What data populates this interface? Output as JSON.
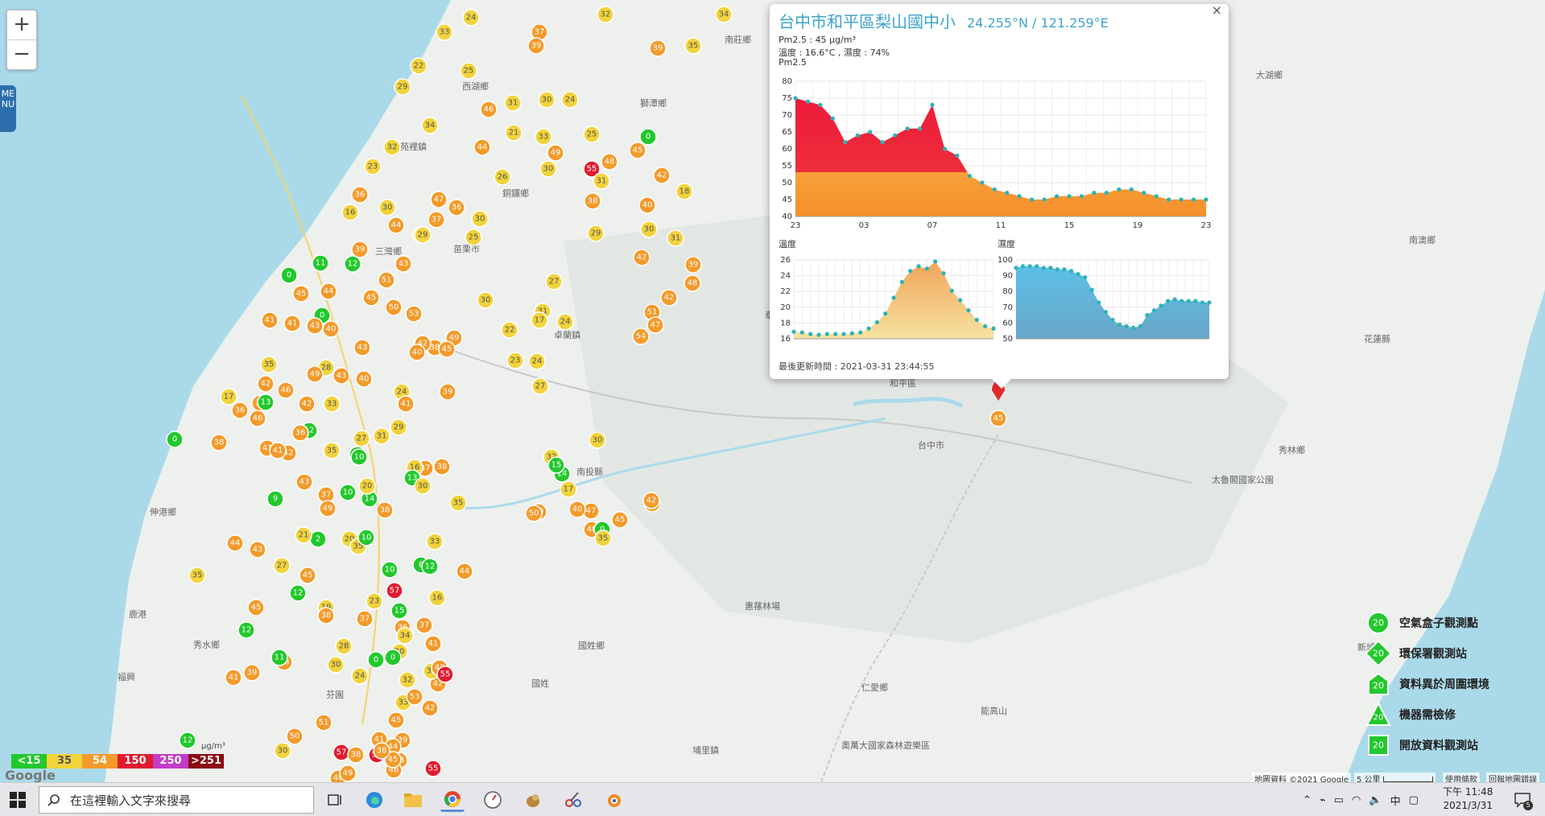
{
  "map": {
    "zoom_in": "+",
    "zoom_out": "−",
    "menu_label": "MENU",
    "places": [
      "南莊鄉",
      "獅潭鄉",
      "大湖鄉",
      "泰安鄉",
      "卓蘭鎮",
      "和平區",
      "南澳鄉",
      "秀林鄉",
      "太魯閣國家公園",
      "仁愛鄉",
      "惠蓀林場",
      "國姓鄉",
      "埔里鎮",
      "鹿港",
      "秀水鄉",
      "福興",
      "伸港鄉",
      "西湖鄉",
      "苑裡鎮",
      "苗栗市",
      "三灣鄉",
      "銅鑼鄉",
      "花蓮縣",
      "奧萬大國家森林遊樂區",
      "能高山",
      "新城",
      "台中市",
      "芬園",
      "國姓",
      "南投縣"
    ],
    "scale_label": "μg/m³"
  },
  "popup": {
    "close": "×",
    "title": "台中市和平區梨山國中小",
    "coord": "24.255°N / 121.259°E",
    "pm25_line": "Pm2.5 : 45 μg/m³",
    "temp_hum_line": "溫度 : 16.6°C , 濕度 : 74%",
    "chart_title": "Pm2.5",
    "temp_title": "溫度",
    "hum_title": "濕度",
    "updated": "最後更新時間 : 2021-03-31 23:44:55"
  },
  "chart_data": [
    {
      "type": "area",
      "title": "Pm2.5",
      "x_tick_labels": [
        "23",
        "03",
        "07",
        "11",
        "15",
        "19",
        "23"
      ],
      "ylim": [
        40,
        80
      ],
      "y_ticks": [
        40,
        45,
        50,
        55,
        60,
        65,
        70,
        75,
        80
      ],
      "values": [
        75,
        74,
        73,
        69,
        62,
        64,
        65,
        62,
        64,
        66,
        66,
        73,
        60,
        58,
        52,
        50,
        48,
        47,
        46,
        45,
        45,
        46,
        46,
        46,
        47,
        47,
        48,
        48,
        47,
        46,
        45,
        45,
        45,
        45
      ]
    },
    {
      "type": "area",
      "title": "溫度",
      "ylim": [
        16,
        26
      ],
      "y_ticks": [
        16,
        18,
        20,
        22,
        24,
        26
      ],
      "values": [
        16.9,
        16.8,
        16.6,
        16.5,
        16.6,
        16.6,
        16.6,
        16.7,
        16.8,
        17.3,
        18.1,
        19.2,
        21.2,
        23.2,
        24.6,
        25.2,
        24.9,
        25.8,
        24.3,
        22.1,
        20.9,
        19.6,
        18.4,
        17.6,
        17.3
      ]
    },
    {
      "type": "area",
      "title": "濕度",
      "ylim": [
        50,
        100
      ],
      "y_ticks": [
        50,
        60,
        70,
        80,
        90,
        100
      ],
      "values": [
        95,
        96,
        96,
        96,
        95,
        95,
        94,
        94,
        93,
        91,
        89,
        81,
        73,
        67,
        62,
        59,
        58,
        57,
        58,
        65,
        68,
        71,
        74,
        75,
        74,
        74,
        74,
        73,
        73
      ]
    }
  ],
  "scale": {
    "labels": [
      "<15",
      "35",
      "54",
      "150",
      "250",
      ">251"
    ],
    "colors": [
      "#22c82c",
      "#f2d33c",
      "#f39a2a",
      "#e01b30",
      "#c43cc8",
      "#8b0a12"
    ]
  },
  "attribution": {
    "data": "地圖資料 ©2021 Google",
    "distance": "5 公里",
    "terms": "使用條款",
    "report": "回報地圖錯誤",
    "google": "Google"
  },
  "legend": {
    "items": [
      {
        "label": "空氣盒子觀測點",
        "value": "20"
      },
      {
        "label": "環保署觀測站",
        "value": "20"
      },
      {
        "label": "資料異於周圍環境",
        "value": "20"
      },
      {
        "label": "機器需檢修",
        "value": "20"
      },
      {
        "label": "開放資料觀測站",
        "value": "20"
      }
    ]
  },
  "taskbar": {
    "search_placeholder": "在這裡輸入文字來搜尋",
    "ime": "中",
    "time": "下午 11:48",
    "date": "2021/3/31",
    "notification_count": "5"
  },
  "markers": [
    {
      "v": "33",
      "c": "#f2d33c"
    },
    {
      "v": "24",
      "c": "#f2d33c"
    },
    {
      "v": "37",
      "c": "#f39a2a"
    },
    {
      "v": "32",
      "c": "#f2d33c"
    },
    {
      "v": "34",
      "c": "#f2d33c"
    },
    {
      "v": "22",
      "c": "#f2d33c"
    },
    {
      "v": "29",
      "c": "#f2d33c"
    },
    {
      "v": "25",
      "c": "#f2d33c"
    },
    {
      "v": "39",
      "c": "#f39a2a"
    },
    {
      "v": "35",
      "c": "#f2d33c"
    },
    {
      "v": "39",
      "c": "#f39a2a"
    },
    {
      "v": "46",
      "c": "#f39a2a"
    },
    {
      "v": "31",
      "c": "#f2d33c"
    },
    {
      "v": "30",
      "c": "#f2d33c"
    },
    {
      "v": "24",
      "c": "#f2d33c"
    },
    {
      "v": "34",
      "c": "#f2d33c"
    },
    {
      "v": "32",
      "c": "#f2d33c"
    },
    {
      "v": "44",
      "c": "#f39a2a"
    },
    {
      "v": "21",
      "c": "#f2d33c"
    },
    {
      "v": "33",
      "c": "#f2d33c"
    },
    {
      "v": "48",
      "c": "#f39a2a"
    },
    {
      "v": "42",
      "c": "#f39a2a"
    },
    {
      "v": "23",
      "c": "#f2d33c"
    },
    {
      "v": "26",
      "c": "#f2d33c"
    },
    {
      "v": "30",
      "c": "#f2d33c"
    },
    {
      "v": "36",
      "c": "#f39a2a"
    },
    {
      "v": "30",
      "c": "#f2d33c"
    },
    {
      "v": "47",
      "c": "#f39a2a"
    },
    {
      "v": "36",
      "c": "#f39a2a"
    },
    {
      "v": "16",
      "c": "#f2d33c"
    },
    {
      "v": "30",
      "c": "#f2d33c"
    },
    {
      "v": "44",
      "c": "#f39a2a"
    },
    {
      "v": "25",
      "c": "#f2d33c"
    },
    {
      "v": "37",
      "c": "#f39a2a"
    },
    {
      "v": "38",
      "c": "#f39a2a"
    },
    {
      "v": "40",
      "c": "#f39a2a"
    },
    {
      "v": "29",
      "c": "#f2d33c"
    },
    {
      "v": "25",
      "c": "#f2d33c"
    },
    {
      "v": "39",
      "c": "#f39a2a"
    },
    {
      "v": "43",
      "c": "#f39a2a"
    },
    {
      "v": "42",
      "c": "#f39a2a"
    },
    {
      "v": "0",
      "c": "#22c82c"
    },
    {
      "v": "11",
      "c": "#22c82c"
    },
    {
      "v": "12",
      "c": "#22c82c"
    },
    {
      "v": "51",
      "c": "#f39a2a"
    },
    {
      "v": "27",
      "c": "#f2d33c"
    },
    {
      "v": "30",
      "c": "#f2d33c"
    },
    {
      "v": "39",
      "c": "#f39a2a"
    },
    {
      "v": "48",
      "c": "#f39a2a"
    },
    {
      "v": "45",
      "c": "#f39a2a"
    },
    {
      "v": "44",
      "c": "#f39a2a"
    },
    {
      "v": "45",
      "c": "#f39a2a"
    },
    {
      "v": "50",
      "c": "#f39a2a"
    },
    {
      "v": "53",
      "c": "#f39a2a"
    },
    {
      "v": "31",
      "c": "#f2d33c"
    },
    {
      "v": "24",
      "c": "#f2d33c"
    },
    {
      "v": "42",
      "c": "#f39a2a"
    },
    {
      "v": "51",
      "c": "#f39a2a"
    },
    {
      "v": "47",
      "c": "#f39a2a"
    },
    {
      "v": "41",
      "c": "#f39a2a"
    },
    {
      "v": "41",
      "c": "#f39a2a"
    },
    {
      "v": "0",
      "c": "#22c82c"
    },
    {
      "v": "43",
      "c": "#f39a2a"
    },
    {
      "v": "40",
      "c": "#f39a2a"
    },
    {
      "v": "54",
      "c": "#f39a2a"
    },
    {
      "v": "49",
      "c": "#f39a2a"
    },
    {
      "v": "38",
      "c": "#f39a2a"
    },
    {
      "v": "43",
      "c": "#f39a2a"
    },
    {
      "v": "45",
      "c": "#f39a2a"
    },
    {
      "v": "28",
      "c": "#f2d33c"
    },
    {
      "v": "35",
      "c": "#f2d33c"
    },
    {
      "v": "42",
      "c": "#f39a2a"
    },
    {
      "v": "46",
      "c": "#f39a2a"
    },
    {
      "v": "49",
      "c": "#f39a2a"
    },
    {
      "v": "42",
      "c": "#f39a2a"
    },
    {
      "v": "40",
      "c": "#f39a2a"
    },
    {
      "v": "43",
      "c": "#f39a2a"
    },
    {
      "v": "40",
      "c": "#f39a2a"
    },
    {
      "v": "24",
      "c": "#f2d33c"
    },
    {
      "v": "39",
      "c": "#f39a2a"
    },
    {
      "v": "41",
      "c": "#f39a2a"
    },
    {
      "v": "33",
      "c": "#f2d33c"
    },
    {
      "v": "17",
      "c": "#f2d33c"
    },
    {
      "v": "39",
      "c": "#f39a2a"
    },
    {
      "v": "13",
      "c": "#22c82c"
    },
    {
      "v": "36",
      "c": "#f39a2a"
    },
    {
      "v": "42",
      "c": "#f39a2a"
    },
    {
      "v": "12",
      "c": "#22c82c"
    },
    {
      "v": "0",
      "c": "#22c82c"
    },
    {
      "v": "38",
      "c": "#f39a2a"
    },
    {
      "v": "36",
      "c": "#f39a2a"
    },
    {
      "v": "46",
      "c": "#f39a2a"
    },
    {
      "v": "42",
      "c": "#f39a2a"
    },
    {
      "v": "43",
      "c": "#f39a2a"
    },
    {
      "v": "41",
      "c": "#f39a2a"
    },
    {
      "v": "7",
      "c": "#22c82c"
    },
    {
      "v": "35",
      "c": "#f2d33c"
    },
    {
      "v": "37",
      "c": "#f39a2a"
    },
    {
      "v": "10",
      "c": "#22c82c"
    },
    {
      "v": "31",
      "c": "#f2d33c"
    },
    {
      "v": "29",
      "c": "#f2d33c"
    },
    {
      "v": "27",
      "c": "#f2d33c"
    },
    {
      "v": "16",
      "c": "#f2d33c"
    },
    {
      "v": "38",
      "c": "#f39a2a"
    },
    {
      "v": "13",
      "c": "#22c82c"
    },
    {
      "v": "43",
      "c": "#f39a2a"
    },
    {
      "v": "37",
      "c": "#f39a2a"
    },
    {
      "v": "30",
      "c": "#f2d33c"
    },
    {
      "v": "9",
      "c": "#22c82c"
    },
    {
      "v": "35",
      "c": "#f2d33c"
    },
    {
      "v": "14",
      "c": "#22c82c"
    },
    {
      "v": "10",
      "c": "#22c82c"
    },
    {
      "v": "20",
      "c": "#f2d33c"
    },
    {
      "v": "38",
      "c": "#f39a2a"
    },
    {
      "v": "49",
      "c": "#f39a2a"
    },
    {
      "v": "2",
      "c": "#22c82c"
    },
    {
      "v": "33",
      "c": "#f2d33c"
    },
    {
      "v": "8",
      "c": "#22c82c"
    },
    {
      "v": "12",
      "c": "#22c82c"
    },
    {
      "v": "44",
      "c": "#f39a2a"
    },
    {
      "v": "20",
      "c": "#f2d33c"
    },
    {
      "v": "21",
      "c": "#f2d33c"
    },
    {
      "v": "35",
      "c": "#f2d33c"
    },
    {
      "v": "10",
      "c": "#22c82c"
    },
    {
      "v": "44",
      "c": "#f39a2a"
    },
    {
      "v": "43",
      "c": "#f39a2a"
    },
    {
      "v": "10",
      "c": "#22c82c"
    },
    {
      "v": "45",
      "c": "#f39a2a"
    },
    {
      "v": "27",
      "c": "#f2d33c"
    },
    {
      "v": "35",
      "c": "#f2d33c"
    },
    {
      "v": "12",
      "c": "#22c82c"
    },
    {
      "v": "12",
      "c": "#22c82c"
    },
    {
      "v": "45",
      "c": "#f39a2a"
    },
    {
      "v": "57",
      "c": "#e01b30"
    },
    {
      "v": "23",
      "c": "#f2d33c"
    },
    {
      "v": "16",
      "c": "#f2d33c"
    },
    {
      "v": "15",
      "c": "#22c82c"
    },
    {
      "v": "37",
      "c": "#f39a2a"
    },
    {
      "v": "36",
      "c": "#f39a2a"
    },
    {
      "v": "19",
      "c": "#f2d33c"
    },
    {
      "v": "34",
      "c": "#f2d33c"
    },
    {
      "v": "41",
      "c": "#f39a2a"
    },
    {
      "v": "42",
      "c": "#f39a2a"
    },
    {
      "v": "38",
      "c": "#f39a2a"
    },
    {
      "v": "20",
      "c": "#f2d33c"
    },
    {
      "v": "37",
      "c": "#f39a2a"
    },
    {
      "v": "28",
      "c": "#f2d33c"
    },
    {
      "v": "30",
      "c": "#f2d33c"
    },
    {
      "v": "48",
      "c": "#f39a2a"
    },
    {
      "v": "0",
      "c": "#22c82c"
    },
    {
      "v": "39",
      "c": "#f39a2a"
    },
    {
      "v": "11",
      "c": "#22c82c"
    },
    {
      "v": "41",
      "c": "#f39a2a"
    },
    {
      "v": "0",
      "c": "#22c82c"
    },
    {
      "v": "24",
      "c": "#f2d33c"
    },
    {
      "v": "30",
      "c": "#f2d33c"
    },
    {
      "v": "32",
      "c": "#f2d33c"
    },
    {
      "v": "33",
      "c": "#f2d33c"
    },
    {
      "v": "42",
      "c": "#f39a2a"
    },
    {
      "v": "12",
      "c": "#22c82c"
    },
    {
      "v": "30",
      "c": "#f2d33c"
    },
    {
      "v": "50",
      "c": "#f39a2a"
    },
    {
      "v": "53",
      "c": "#f39a2a"
    },
    {
      "v": "48",
      "c": "#f39a2a"
    },
    {
      "v": "49",
      "c": "#f39a2a"
    },
    {
      "v": "46",
      "c": "#f39a2a"
    },
    {
      "v": "58",
      "c": "#e01b30"
    },
    {
      "v": "42",
      "c": "#f39a2a"
    },
    {
      "v": "55",
      "c": "#e01b30"
    },
    {
      "v": "53",
      "c": "#f39a2a"
    },
    {
      "v": "57",
      "c": "#e01b30"
    },
    {
      "v": "55",
      "c": "#e01b30"
    },
    {
      "v": "51",
      "c": "#f39a2a"
    },
    {
      "v": "41",
      "c": "#f39a2a"
    },
    {
      "v": "39",
      "c": "#f39a2a"
    },
    {
      "v": "45",
      "c": "#f39a2a"
    },
    {
      "v": "44",
      "c": "#f39a2a"
    },
    {
      "v": "45",
      "c": "#f39a2a"
    },
    {
      "v": "38",
      "c": "#f39a2a"
    },
    {
      "v": "38",
      "c": "#f39a2a"
    },
    {
      "v": "25",
      "c": "#f2d33c"
    },
    {
      "v": "0",
      "c": "#22c82c"
    },
    {
      "v": "49",
      "c": "#f39a2a"
    },
    {
      "v": "55",
      "c": "#e01b30"
    },
    {
      "v": "45",
      "c": "#f39a2a"
    },
    {
      "v": "18",
      "c": "#f2d33c"
    },
    {
      "v": "31",
      "c": "#f2d33c"
    },
    {
      "v": "31",
      "c": "#f2d33c"
    },
    {
      "v": "29",
      "c": "#f2d33c"
    },
    {
      "v": "30",
      "c": "#f2d33c"
    },
    {
      "v": "22",
      "c": "#f2d33c"
    },
    {
      "v": "17",
      "c": "#f2d33c"
    },
    {
      "v": "23",
      "c": "#f2d33c"
    },
    {
      "v": "24",
      "c": "#f2d33c"
    },
    {
      "v": "27",
      "c": "#f2d33c"
    },
    {
      "v": "30",
      "c": "#f2d33c"
    },
    {
      "v": "32",
      "c": "#f2d33c"
    },
    {
      "v": "17",
      "c": "#f2d33c"
    },
    {
      "v": "14",
      "c": "#22c82c"
    },
    {
      "v": "40",
      "c": "#f39a2a"
    },
    {
      "v": "47",
      "c": "#f39a2a"
    },
    {
      "v": "48",
      "c": "#f39a2a"
    },
    {
      "v": "43",
      "c": "#f39a2a"
    },
    {
      "v": "40",
      "c": "#f39a2a"
    },
    {
      "v": "0",
      "c": "#22c82c"
    },
    {
      "v": "45",
      "c": "#f39a2a"
    },
    {
      "v": "35",
      "c": "#f2d33c"
    },
    {
      "v": "42",
      "c": "#f39a2a"
    },
    {
      "v": "50",
      "c": "#f39a2a"
    },
    {
      "v": "15",
      "c": "#22c82c"
    }
  ]
}
